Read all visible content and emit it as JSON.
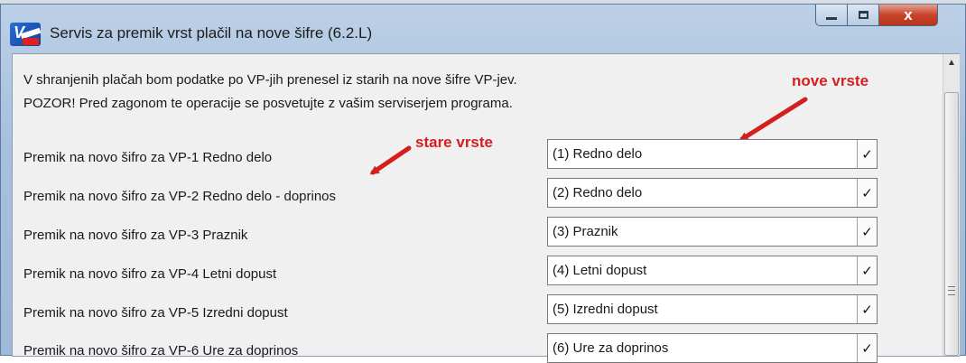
{
  "window": {
    "title": "Servis za premik vrst plačil na nove šifre  (6.2.L)",
    "icon": "app-logo-icon",
    "controls": {
      "minimize": "minimize-icon",
      "maximize": "maximize-icon",
      "close": "x"
    }
  },
  "intro": {
    "line1": "V shranjenih plačah bom podatke po VP-jih prenesel iz starih na nove šifre VP-jev.",
    "line2": "POZOR! Pred zagonom te operacije se posvetujte z vašim serviserjem programa."
  },
  "annotations": {
    "new_types": "nove vrste",
    "old_types": "stare vrste",
    "color": "#d41f1f"
  },
  "rows": [
    {
      "label": "Premik na novo šifro za  VP-1  Redno delo",
      "value": "(1) Redno delo",
      "check": "✓"
    },
    {
      "label": "Premik na novo šifro za  VP-2  Redno delo - doprinos",
      "value": "(2) Redno delo",
      "check": "✓"
    },
    {
      "label": "Premik na novo šifro za  VP-3  Praznik",
      "value": "(3) Praznik",
      "check": "✓"
    },
    {
      "label": "Premik na novo šifro za  VP-4  Letni dopust",
      "value": "(4) Letni dopust",
      "check": "✓"
    },
    {
      "label": "Premik na novo šifro za  VP-5  Izredni dopust",
      "value": "(5) Izredni dopust",
      "check": "✓"
    },
    {
      "label": "Premik na novo šifro za  VP-6  Ure za doprinos",
      "value": "(6) Ure za doprinos",
      "check": "✓"
    }
  ],
  "scrollbar": {
    "up": "▲",
    "grip": "scroll-grip-icon"
  }
}
